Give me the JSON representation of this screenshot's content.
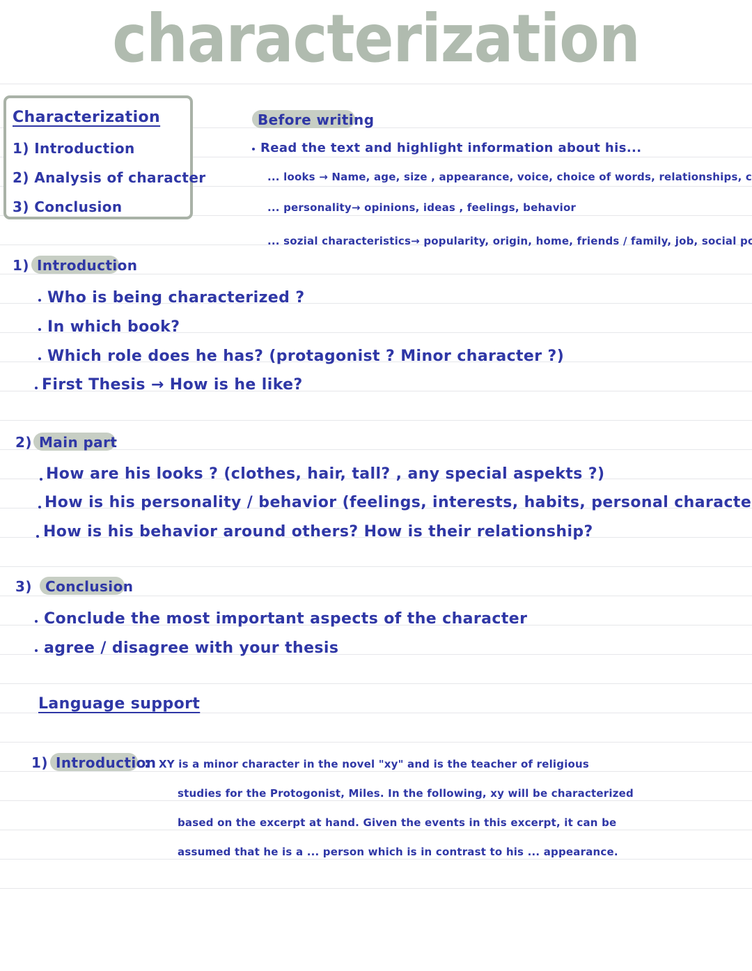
{
  "page": {
    "title": "characterization",
    "ink_color": "#2f37a6",
    "title_color": "#b0bbaf",
    "highlight_color": "#c7cec4",
    "rule_color": "#e6e7ea",
    "box_border_color": "#a9b2a7"
  },
  "toc_box": {
    "heading": "Characterization",
    "items": [
      "1) Introduction",
      "2) Analysis of character",
      "3) Conclusion"
    ]
  },
  "before_writing": {
    "heading": "Before writing",
    "bullet": "Read the text and highlight information about his...",
    "sub_items": [
      "... looks → Name, age, size , appearance, voice, choice of words, relationships, clothes",
      "... personality→ opinions, ideas , feelings, behavior",
      "... sozial characteristics→ popularity, origin, home, friends / family,  job,  social position"
    ]
  },
  "section_introduction": {
    "number": "1)",
    "heading": "Introduction",
    "bullets": [
      "Who is being characterized ?",
      "In which book?",
      "Which role  does he has? (protagonist ? Minor character ?)",
      "First Thesis → How is  he like?"
    ]
  },
  "section_main_part": {
    "number": "2)",
    "heading": "Main part",
    "bullets": [
      "How are his looks ? (clothes, hair, tall? , any special aspekts ?)",
      "How is his personality / behavior  (feelings, interests, habits, personal characteristics)",
      "How is his behavior around others? How is  their  relationship?"
    ]
  },
  "section_conclusion": {
    "number": "3)",
    "heading": "Conclusion",
    "bullets": [
      "Conclude  the most important aspects of the  character",
      "agree / disagree with your thesis"
    ]
  },
  "language_support": {
    "heading": "Language support",
    "example": {
      "number": "1)",
      "label": "Introduction",
      "colon": ":",
      "lines": [
        "XY is  a  minor  character in  the  novel \"xy\"  and is  the  teacher of  religious",
        "studies for the Protogonist, Miles. In the following,  xy   will be  characterized",
        "based  on  the  excerpt  at  hand.  Given the events in this  excerpt,  it  can be",
        "assumed that  he is a   ...   person  which  is  in contrast  to  his ...  appearance."
      ]
    }
  }
}
